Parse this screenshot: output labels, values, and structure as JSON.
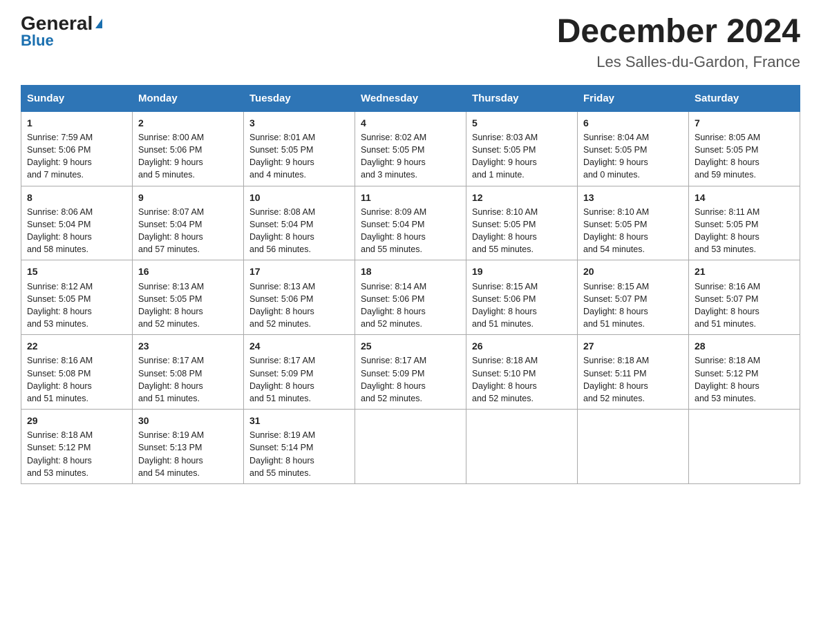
{
  "header": {
    "logo_general": "General",
    "logo_blue": "Blue",
    "month_title": "December 2024",
    "location": "Les Salles-du-Gardon, France"
  },
  "days_of_week": [
    "Sunday",
    "Monday",
    "Tuesday",
    "Wednesday",
    "Thursday",
    "Friday",
    "Saturday"
  ],
  "weeks": [
    [
      {
        "day": "1",
        "sunrise": "Sunrise: 7:59 AM",
        "sunset": "Sunset: 5:06 PM",
        "daylight": "Daylight: 9 hours",
        "daylight2": "and 7 minutes."
      },
      {
        "day": "2",
        "sunrise": "Sunrise: 8:00 AM",
        "sunset": "Sunset: 5:06 PM",
        "daylight": "Daylight: 9 hours",
        "daylight2": "and 5 minutes."
      },
      {
        "day": "3",
        "sunrise": "Sunrise: 8:01 AM",
        "sunset": "Sunset: 5:05 PM",
        "daylight": "Daylight: 9 hours",
        "daylight2": "and 4 minutes."
      },
      {
        "day": "4",
        "sunrise": "Sunrise: 8:02 AM",
        "sunset": "Sunset: 5:05 PM",
        "daylight": "Daylight: 9 hours",
        "daylight2": "and 3 minutes."
      },
      {
        "day": "5",
        "sunrise": "Sunrise: 8:03 AM",
        "sunset": "Sunset: 5:05 PM",
        "daylight": "Daylight: 9 hours",
        "daylight2": "and 1 minute."
      },
      {
        "day": "6",
        "sunrise": "Sunrise: 8:04 AM",
        "sunset": "Sunset: 5:05 PM",
        "daylight": "Daylight: 9 hours",
        "daylight2": "and 0 minutes."
      },
      {
        "day": "7",
        "sunrise": "Sunrise: 8:05 AM",
        "sunset": "Sunset: 5:05 PM",
        "daylight": "Daylight: 8 hours",
        "daylight2": "and 59 minutes."
      }
    ],
    [
      {
        "day": "8",
        "sunrise": "Sunrise: 8:06 AM",
        "sunset": "Sunset: 5:04 PM",
        "daylight": "Daylight: 8 hours",
        "daylight2": "and 58 minutes."
      },
      {
        "day": "9",
        "sunrise": "Sunrise: 8:07 AM",
        "sunset": "Sunset: 5:04 PM",
        "daylight": "Daylight: 8 hours",
        "daylight2": "and 57 minutes."
      },
      {
        "day": "10",
        "sunrise": "Sunrise: 8:08 AM",
        "sunset": "Sunset: 5:04 PM",
        "daylight": "Daylight: 8 hours",
        "daylight2": "and 56 minutes."
      },
      {
        "day": "11",
        "sunrise": "Sunrise: 8:09 AM",
        "sunset": "Sunset: 5:04 PM",
        "daylight": "Daylight: 8 hours",
        "daylight2": "and 55 minutes."
      },
      {
        "day": "12",
        "sunrise": "Sunrise: 8:10 AM",
        "sunset": "Sunset: 5:05 PM",
        "daylight": "Daylight: 8 hours",
        "daylight2": "and 55 minutes."
      },
      {
        "day": "13",
        "sunrise": "Sunrise: 8:10 AM",
        "sunset": "Sunset: 5:05 PM",
        "daylight": "Daylight: 8 hours",
        "daylight2": "and 54 minutes."
      },
      {
        "day": "14",
        "sunrise": "Sunrise: 8:11 AM",
        "sunset": "Sunset: 5:05 PM",
        "daylight": "Daylight: 8 hours",
        "daylight2": "and 53 minutes."
      }
    ],
    [
      {
        "day": "15",
        "sunrise": "Sunrise: 8:12 AM",
        "sunset": "Sunset: 5:05 PM",
        "daylight": "Daylight: 8 hours",
        "daylight2": "and 53 minutes."
      },
      {
        "day": "16",
        "sunrise": "Sunrise: 8:13 AM",
        "sunset": "Sunset: 5:05 PM",
        "daylight": "Daylight: 8 hours",
        "daylight2": "and 52 minutes."
      },
      {
        "day": "17",
        "sunrise": "Sunrise: 8:13 AM",
        "sunset": "Sunset: 5:06 PM",
        "daylight": "Daylight: 8 hours",
        "daylight2": "and 52 minutes."
      },
      {
        "day": "18",
        "sunrise": "Sunrise: 8:14 AM",
        "sunset": "Sunset: 5:06 PM",
        "daylight": "Daylight: 8 hours",
        "daylight2": "and 52 minutes."
      },
      {
        "day": "19",
        "sunrise": "Sunrise: 8:15 AM",
        "sunset": "Sunset: 5:06 PM",
        "daylight": "Daylight: 8 hours",
        "daylight2": "and 51 minutes."
      },
      {
        "day": "20",
        "sunrise": "Sunrise: 8:15 AM",
        "sunset": "Sunset: 5:07 PM",
        "daylight": "Daylight: 8 hours",
        "daylight2": "and 51 minutes."
      },
      {
        "day": "21",
        "sunrise": "Sunrise: 8:16 AM",
        "sunset": "Sunset: 5:07 PM",
        "daylight": "Daylight: 8 hours",
        "daylight2": "and 51 minutes."
      }
    ],
    [
      {
        "day": "22",
        "sunrise": "Sunrise: 8:16 AM",
        "sunset": "Sunset: 5:08 PM",
        "daylight": "Daylight: 8 hours",
        "daylight2": "and 51 minutes."
      },
      {
        "day": "23",
        "sunrise": "Sunrise: 8:17 AM",
        "sunset": "Sunset: 5:08 PM",
        "daylight": "Daylight: 8 hours",
        "daylight2": "and 51 minutes."
      },
      {
        "day": "24",
        "sunrise": "Sunrise: 8:17 AM",
        "sunset": "Sunset: 5:09 PM",
        "daylight": "Daylight: 8 hours",
        "daylight2": "and 51 minutes."
      },
      {
        "day": "25",
        "sunrise": "Sunrise: 8:17 AM",
        "sunset": "Sunset: 5:09 PM",
        "daylight": "Daylight: 8 hours",
        "daylight2": "and 52 minutes."
      },
      {
        "day": "26",
        "sunrise": "Sunrise: 8:18 AM",
        "sunset": "Sunset: 5:10 PM",
        "daylight": "Daylight: 8 hours",
        "daylight2": "and 52 minutes."
      },
      {
        "day": "27",
        "sunrise": "Sunrise: 8:18 AM",
        "sunset": "Sunset: 5:11 PM",
        "daylight": "Daylight: 8 hours",
        "daylight2": "and 52 minutes."
      },
      {
        "day": "28",
        "sunrise": "Sunrise: 8:18 AM",
        "sunset": "Sunset: 5:12 PM",
        "daylight": "Daylight: 8 hours",
        "daylight2": "and 53 minutes."
      }
    ],
    [
      {
        "day": "29",
        "sunrise": "Sunrise: 8:18 AM",
        "sunset": "Sunset: 5:12 PM",
        "daylight": "Daylight: 8 hours",
        "daylight2": "and 53 minutes."
      },
      {
        "day": "30",
        "sunrise": "Sunrise: 8:19 AM",
        "sunset": "Sunset: 5:13 PM",
        "daylight": "Daylight: 8 hours",
        "daylight2": "and 54 minutes."
      },
      {
        "day": "31",
        "sunrise": "Sunrise: 8:19 AM",
        "sunset": "Sunset: 5:14 PM",
        "daylight": "Daylight: 8 hours",
        "daylight2": "and 55 minutes."
      },
      {
        "day": "",
        "sunrise": "",
        "sunset": "",
        "daylight": "",
        "daylight2": ""
      },
      {
        "day": "",
        "sunrise": "",
        "sunset": "",
        "daylight": "",
        "daylight2": ""
      },
      {
        "day": "",
        "sunrise": "",
        "sunset": "",
        "daylight": "",
        "daylight2": ""
      },
      {
        "day": "",
        "sunrise": "",
        "sunset": "",
        "daylight": "",
        "daylight2": ""
      }
    ]
  ]
}
